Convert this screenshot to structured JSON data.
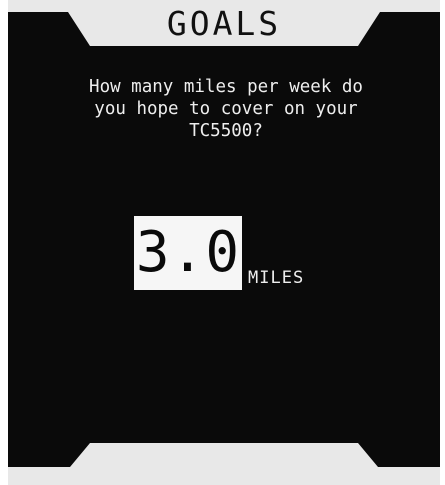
{
  "header": {
    "title": "GOALS"
  },
  "prompt": {
    "question": "How many miles per week do\nyou hope to cover on your\nTC5500?"
  },
  "goal": {
    "value": "3.0",
    "unit": "MILES"
  },
  "colors": {
    "background": "#0a0a0a",
    "banner": "#e8e8e8",
    "text": "#eeeeee",
    "value_box": "#f6f6f6"
  }
}
